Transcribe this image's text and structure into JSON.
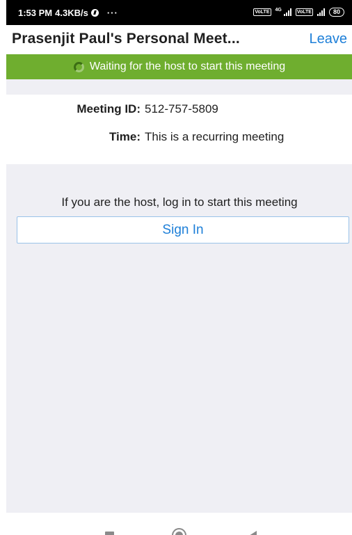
{
  "status_bar": {
    "time": "1:53 PM",
    "speed": "4.3KB/s",
    "more": "···",
    "network_type": "4G",
    "volte_1": "VoLTE",
    "volte_2": "VoLTE",
    "battery": "80"
  },
  "header": {
    "title": "Prasenjit Paul's Personal Meet...",
    "leave_label": "Leave"
  },
  "banner": {
    "text": "Waiting for the host to start this meeting",
    "color": "#6fae2f"
  },
  "meeting": {
    "id_label": "Meeting ID:",
    "id_value": "512-757-5809",
    "time_label": "Time:",
    "time_value": "This is a recurring meeting"
  },
  "host": {
    "prompt": "If you are the host, log in to start this meeting",
    "sign_in_label": "Sign In"
  },
  "colors": {
    "accent": "#1d7fd8",
    "background_gray": "#efeff4"
  },
  "icons": {
    "spinner": "spinner-icon",
    "nav_recent": "recent-apps-icon",
    "nav_home": "home-icon",
    "nav_back": "back-icon"
  }
}
